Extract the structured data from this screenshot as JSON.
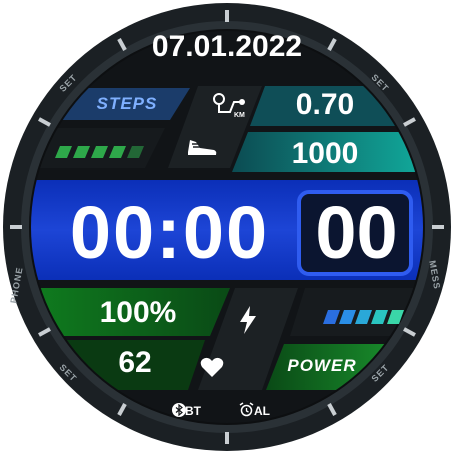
{
  "date": "07.01.2022",
  "steps": {
    "label": "STEPS",
    "distance": "0.70",
    "distance_unit": "KM",
    "count": "1000"
  },
  "time": {
    "hours_minutes": "00:00",
    "seconds": "00"
  },
  "battery": {
    "percent_text": "100%",
    "level": 1.0
  },
  "heart_rate": "62",
  "power": {
    "label": "POWER",
    "level_segments": 5
  },
  "status": {
    "bt": "BT",
    "alarm": "AL"
  },
  "bezel": {
    "set": "SET",
    "phone": "PHONE",
    "mess": "MESS"
  },
  "colors": {
    "accent_blue": "#1f4fd8",
    "accent_green": "#1a8a2a",
    "accent_teal": "#1a9a8a",
    "bezel": "#1c2226",
    "background": "#0e1012"
  },
  "icons": [
    "distance-km-icon",
    "shoe-icon",
    "lightning-icon",
    "heart-icon",
    "bluetooth-icon",
    "alarm-icon"
  ]
}
